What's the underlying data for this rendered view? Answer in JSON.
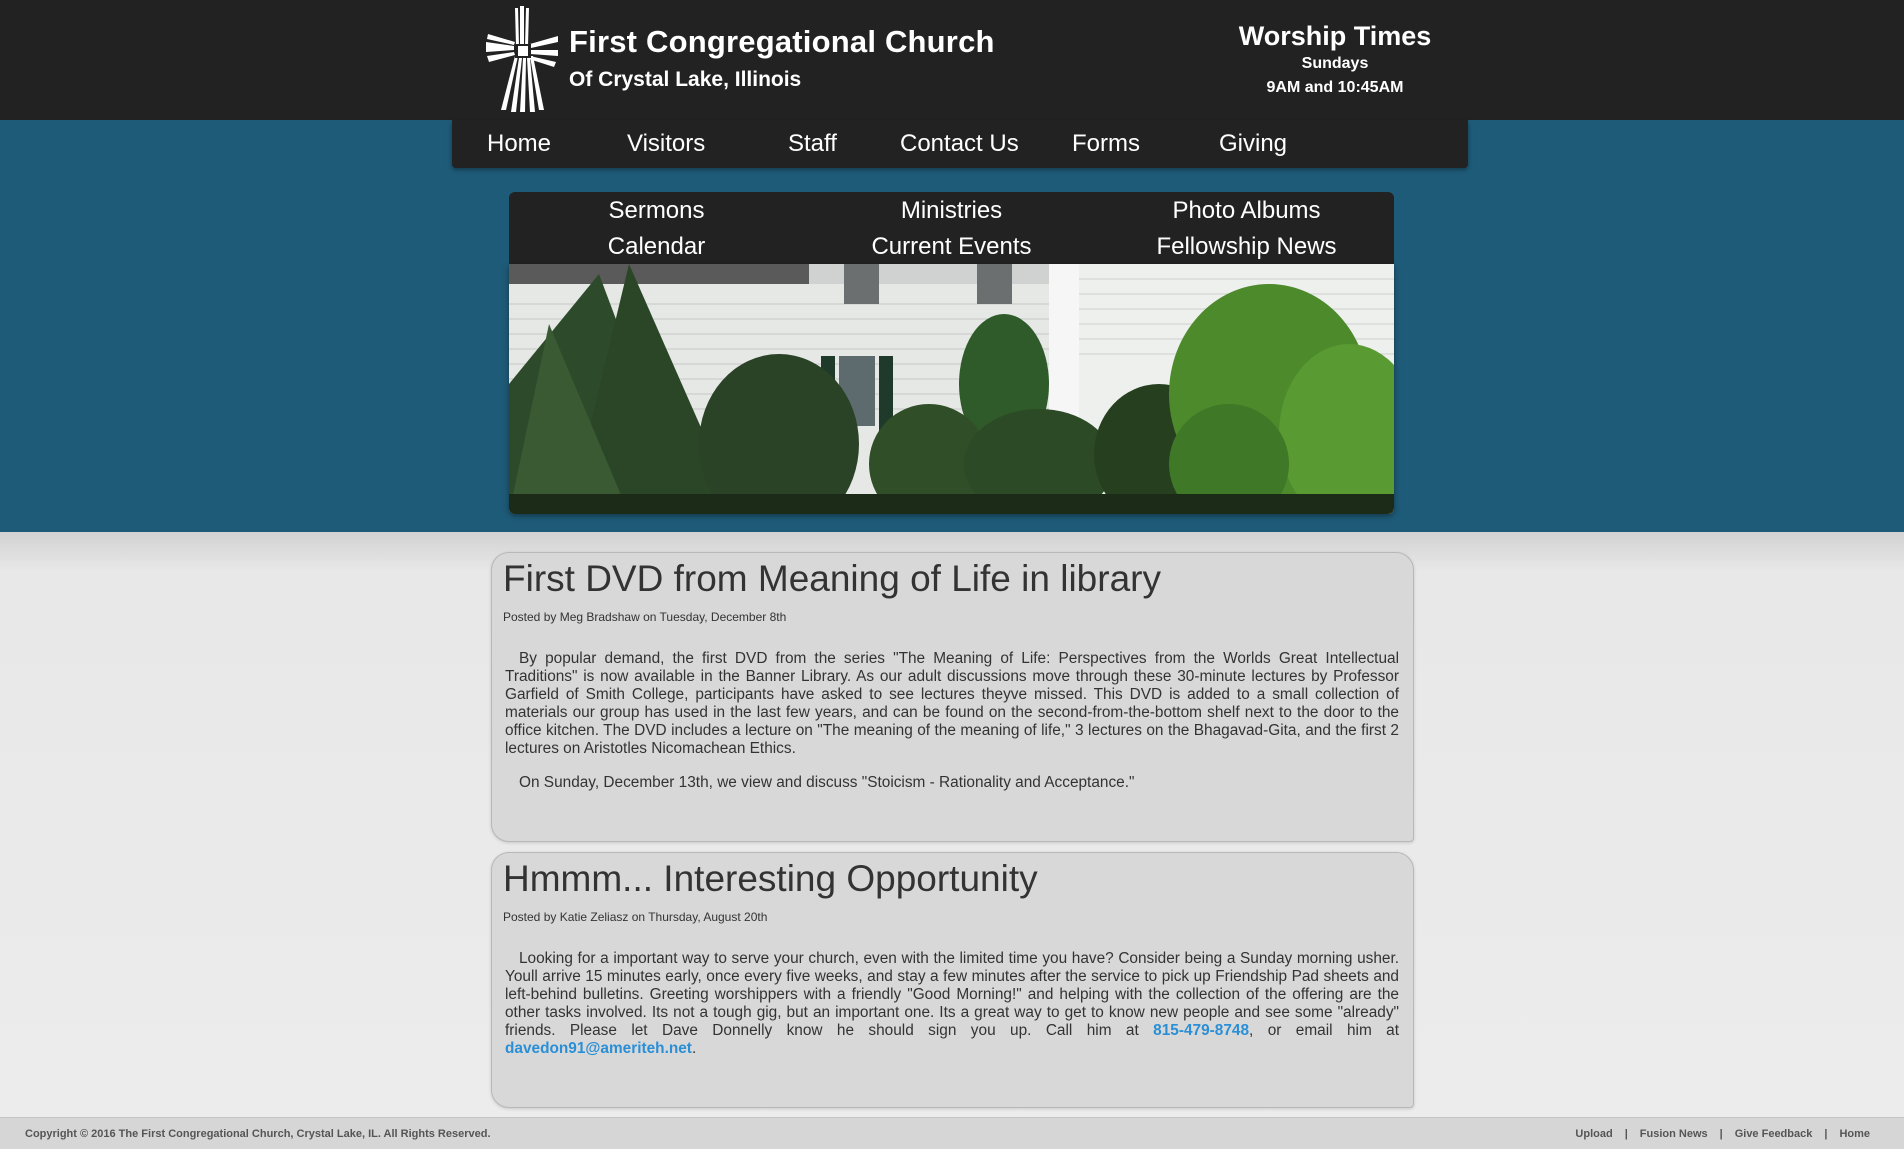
{
  "header": {
    "title": "First Congregational Church",
    "subtitle": "Of Crystal Lake, Illinois",
    "worship": {
      "title": "Worship Times",
      "day": "Sundays",
      "times": "9AM and 10:45AM"
    }
  },
  "main_nav": [
    "Home",
    "Visitors",
    "Staff",
    "Contact Us",
    "Forms",
    "Giving"
  ],
  "sub_nav": {
    "row1": [
      "Sermons",
      "Ministries",
      "Photo Albums"
    ],
    "row2": [
      "Calendar",
      "Current Events",
      "Fellowship News"
    ]
  },
  "posts": [
    {
      "title": "First DVD from Meaning of Life in library",
      "meta": "Posted by Meg Bradshaw on Tuesday, December 8th",
      "p1": "By popular demand, the first DVD from the series \"The Meaning of Life:  Perspectives from the Worlds Great Intellectual Traditions\" is now available in the Banner Library.  As our adult discussions move through these 30-minute lectures by Professor Garfield of Smith College, participants have asked to see lectures theyve missed.  This DVD is added to a small collection of materials our group has used in the last few years, and can be found on the second-from-the-bottom shelf next to the door to the office kitchen.  The DVD includes a lecture on \"The meaning of the meaning of life,\" 3 lectures on the Bhagavad-Gita, and the first 2 lectures on Aristotles Nicomachean Ethics.",
      "p2": "On Sunday, December 13th, we view and discuss \"Stoicism - Rationality and Acceptance.\""
    },
    {
      "title": "Hmmm... Interesting Opportunity",
      "meta": "Posted by Katie Zeliasz on Thursday, August 20th",
      "p1_before": "Looking for a important way to serve your church, even with the limited time you have?  Consider being a Sunday morning usher.  Youll arrive 15 minutes early, once every five weeks, and stay a few minutes after the service to pick up Friendship Pad sheets and left-behind bulletins.  Greeting worshippers with a friendly \"Good Morning!\" and helping with the collection of the offering are the other tasks involved.  Its not a tough gig, but an important one.  Its a great way to get to know new people and see some \"already\" friends.  Please let Dave Donnelly know he should sign you up.  Call him at ",
      "phone": "815-479-8748",
      "p1_middle": ", or email him at ",
      "email": "davedon91@ameriteh.net",
      "p1_after": "."
    }
  ],
  "footer": {
    "copyright": "Copyright © 2016 The First Congregational Church, Crystal Lake, IL. All Rights Reserved.",
    "links": [
      "Upload",
      "Fusion News",
      "Give Feedback",
      "Home"
    ],
    "separator": "|"
  },
  "colors": {
    "header": "#222222",
    "teal": "#1e5b78",
    "link": "#2a8fd6"
  },
  "icons": {
    "logo": "cross-logo-icon"
  }
}
